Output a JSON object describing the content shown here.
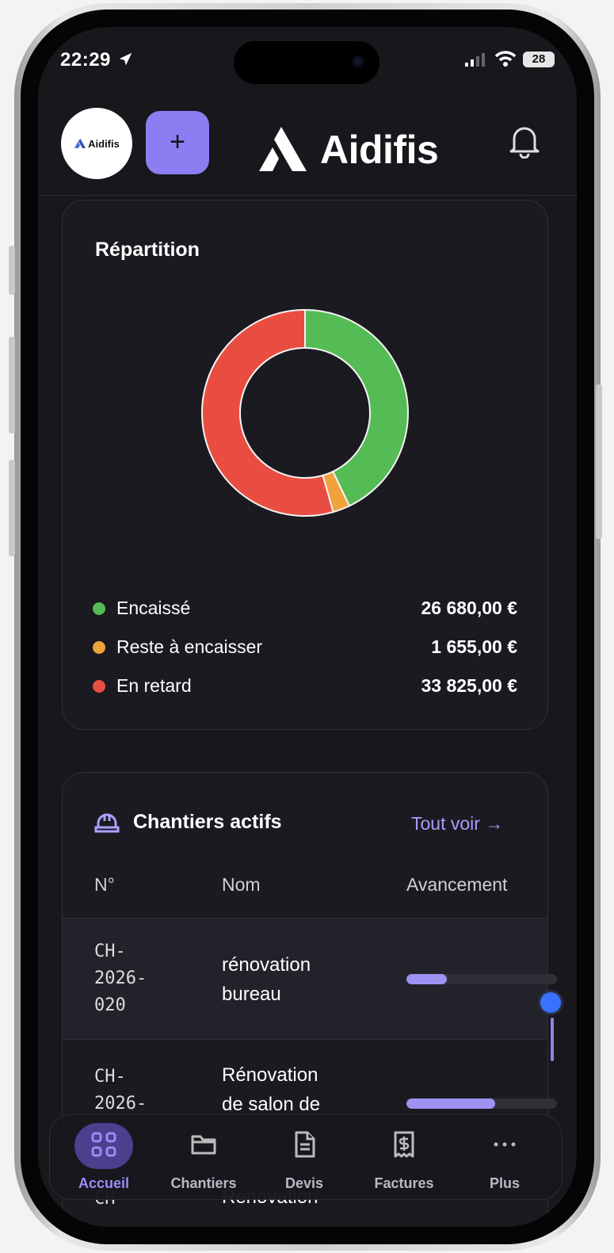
{
  "status": {
    "time": "22:29",
    "battery": "28"
  },
  "header": {
    "logo_text": "Aidifis",
    "add_label": "+",
    "brand": "Aidifis"
  },
  "distribution": {
    "title": "Répartition",
    "chart_data": {
      "type": "pie",
      "categories": [
        "Encaissé",
        "Reste à encaisser",
        "En retard"
      ],
      "values": [
        26680,
        1655,
        33825
      ],
      "colors": [
        "#55bb55",
        "#f0a23d",
        "#e94d41"
      ],
      "title": ""
    },
    "legend": [
      {
        "label": "Encaissé",
        "value": "26 680,00 €",
        "color": "#55bb55"
      },
      {
        "label": "Reste à encaisser",
        "value": "1 655,00 €",
        "color": "#f0a23d"
      },
      {
        "label": "En retard",
        "value": "33 825,00 €",
        "color": "#e94d41"
      }
    ]
  },
  "sites": {
    "title": "Chantiers actifs",
    "view_all": "Tout voir →",
    "columns": [
      "N°",
      "Nom",
      "Avancement"
    ],
    "rows": [
      {
        "number": "CH-\n2026-\n020",
        "name": "rénovation\nbureau",
        "progress": 0.27
      },
      {
        "number": "CH-\n2026-",
        "name": "Rénovation\nde salon de",
        "progress": 0.59
      },
      {
        "number": "CH-",
        "name": "Rénovation",
        "progress": 0
      }
    ]
  },
  "tabs": [
    {
      "label": "Accueil",
      "icon": "grid-icon",
      "active": true
    },
    {
      "label": "Chantiers",
      "icon": "folder-icon",
      "active": false
    },
    {
      "label": "Devis",
      "icon": "document-icon",
      "active": false
    },
    {
      "label": "Factures",
      "icon": "invoice-dollar-icon",
      "active": false
    },
    {
      "label": "Plus",
      "icon": "more-icon",
      "active": false
    }
  ]
}
